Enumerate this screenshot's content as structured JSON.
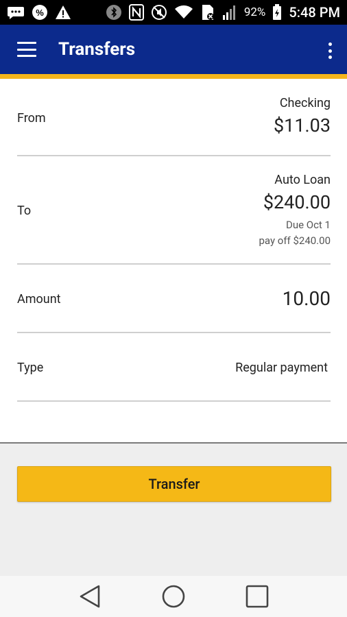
{
  "status_bar": {
    "battery_percent": "92%",
    "time": "5:48 PM",
    "icons": [
      "message-icon",
      "percent-icon",
      "warning-icon",
      "bluetooth-icon",
      "nfc-icon",
      "mute-icon",
      "wifi-icon",
      "sim-icon",
      "signal-icon",
      "battery-icon"
    ]
  },
  "app_bar": {
    "title": "Transfers",
    "menu_icon": "hamburger-icon",
    "overflow_icon": "more-vert-icon",
    "color": "#0c2a8c",
    "accent": "#f5b51c"
  },
  "form": {
    "from": {
      "label": "From",
      "account": "Checking",
      "balance": "$11.03"
    },
    "to": {
      "label": "To",
      "account": "Auto Loan",
      "balance": "$240.00",
      "due": "Due Oct 1",
      "payoff": "pay off $240.00"
    },
    "amount": {
      "label": "Amount",
      "value": "10.00"
    },
    "type": {
      "label": "Type",
      "value": "Regular payment"
    }
  },
  "actions": {
    "transfer_label": "Transfer",
    "button_color": "#f5b816"
  },
  "nav_bar": {
    "icons": [
      "back-icon",
      "home-icon",
      "recents-icon"
    ]
  }
}
